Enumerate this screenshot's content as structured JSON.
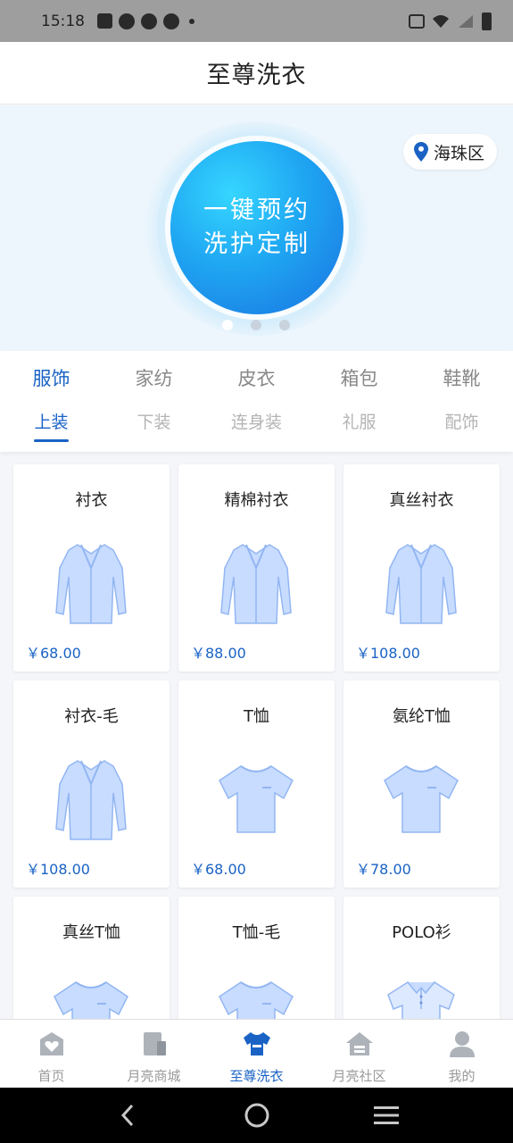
{
  "status_bar": {
    "time": "15:18"
  },
  "header": {
    "title": "至尊洗衣"
  },
  "banner": {
    "cta_line1": "一键预约",
    "cta_line2": "洗护定制",
    "location": "海珠区",
    "slide_count": 3,
    "active_slide": 1
  },
  "categories": {
    "main": [
      "服饰",
      "家纺",
      "皮衣",
      "箱包",
      "鞋靴"
    ],
    "main_active": 0,
    "sub": [
      "上装",
      "下装",
      "连身装",
      "礼服",
      "配饰"
    ],
    "sub_active": 0
  },
  "products": [
    {
      "name": "衬衣",
      "price": "￥68.00",
      "icon": "shirt-icon"
    },
    {
      "name": "精棉衬衣",
      "price": "￥88.00",
      "icon": "shirt-icon"
    },
    {
      "name": "真丝衬衣",
      "price": "￥108.00",
      "icon": "shirt-icon"
    },
    {
      "name": "衬衣-毛",
      "price": "￥108.00",
      "icon": "shirt-icon"
    },
    {
      "name": "T恤",
      "price": "￥68.00",
      "icon": "tshirt-icon"
    },
    {
      "name": "氨纶T恤",
      "price": "￥78.00",
      "icon": "tshirt-icon"
    },
    {
      "name": "真丝T恤",
      "price": "",
      "icon": "tshirt-icon"
    },
    {
      "name": "T恤-毛",
      "price": "",
      "icon": "tshirt-icon"
    },
    {
      "name": "POLO衫",
      "price": "",
      "icon": "polo-icon"
    }
  ],
  "tabbar": {
    "items": [
      {
        "label": "首页",
        "icon": "home-heart-icon"
      },
      {
        "label": "月亮商城",
        "icon": "mall-icon"
      },
      {
        "label": "至尊洗衣",
        "icon": "laundry-shirt-icon"
      },
      {
        "label": "月亮社区",
        "icon": "community-house-icon"
      },
      {
        "label": "我的",
        "icon": "user-icon"
      }
    ],
    "active": 2
  },
  "colors": {
    "accent": "#1a63c5",
    "banner_bg": "#eef6fd",
    "cta_gradient_start": "#35d6ff",
    "cta_gradient_end": "#1a72e0"
  }
}
